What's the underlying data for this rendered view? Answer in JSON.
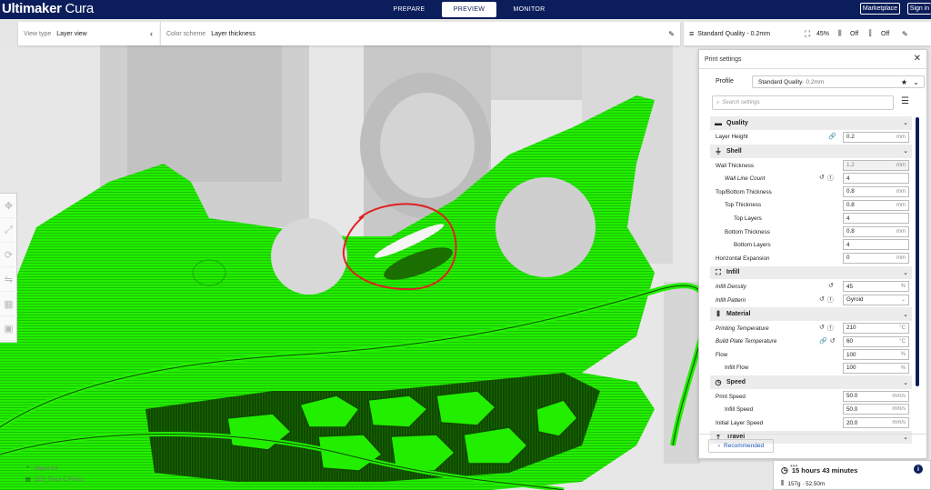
{
  "app": {
    "title_bold": "Ultimaker",
    "title_rest": "Cura"
  },
  "stages": {
    "prepare": "PREPARE",
    "preview": "PREVIEW",
    "monitor": "MONITOR"
  },
  "top_buttons": {
    "marketplace": "Marketplace",
    "signin": "Sign in"
  },
  "view": {
    "view_type_label": "View type",
    "view_type_value": "Layer view",
    "color_scheme_label": "Color scheme",
    "color_scheme_value": "Layer thickness"
  },
  "quick_settings": {
    "profile": "Standard Quality - 0.2mm",
    "infill": "45%",
    "support": "Off",
    "adhesion": "Off"
  },
  "panel": {
    "title": "Print settings",
    "profile_label": "Profile",
    "profile_value": "Standard Quality",
    "profile_suffix": " - 0.2mm",
    "search_placeholder": "Search settings",
    "recommended_button": "Recommended"
  },
  "settings": {
    "quality": {
      "label": "Quality"
    },
    "layer_height": {
      "label": "Layer Height",
      "value": "0.2",
      "unit": "mm"
    },
    "shell": {
      "label": "Shell"
    },
    "wall_thickness": {
      "label": "Wall Thickness",
      "value": "1.2",
      "unit": "mm"
    },
    "wall_line_count": {
      "label": "Wall Line Count",
      "value": "4"
    },
    "top_bottom_thickness": {
      "label": "Top/Bottom Thickness",
      "value": "0.8",
      "unit": "mm"
    },
    "top_thickness": {
      "label": "Top Thickness",
      "value": "0.8",
      "unit": "mm"
    },
    "top_layers": {
      "label": "Top Layers",
      "value": "4"
    },
    "bottom_thickness": {
      "label": "Bottom Thickness",
      "value": "0.8",
      "unit": "mm"
    },
    "bottom_layers": {
      "label": "Bottom Layers",
      "value": "4"
    },
    "horizontal_expansion": {
      "label": "Horizontal Expansion",
      "value": "0",
      "unit": "mm"
    },
    "infill": {
      "label": "Infill"
    },
    "infill_density": {
      "label": "Infill Density",
      "value": "45",
      "unit": "%"
    },
    "infill_pattern": {
      "label": "Infill Pattern",
      "value": "Gyroid"
    },
    "material": {
      "label": "Material"
    },
    "printing_temperature": {
      "label": "Printing Temperature",
      "value": "210",
      "unit": "°C"
    },
    "build_plate_temperature": {
      "label": "Build Plate Temperature",
      "value": "60",
      "unit": "°C"
    },
    "flow": {
      "label": "Flow",
      "value": "100",
      "unit": "%"
    },
    "infill_flow": {
      "label": "Infill Flow",
      "value": "100",
      "unit": "%"
    },
    "speed": {
      "label": "Speed"
    },
    "print_speed": {
      "label": "Print Speed",
      "value": "50.0",
      "unit": "mm/s"
    },
    "infill_speed": {
      "label": "Infill Speed",
      "value": "50.0",
      "unit": "mm/s"
    },
    "initial_layer_speed": {
      "label": "Initial Layer Speed",
      "value": "20.0",
      "unit": "mm/s"
    },
    "travel": {
      "label": "Travel"
    }
  },
  "object_list": {
    "label": "Object list",
    "object_name": "CE3_Truck C Primo"
  },
  "print_info": {
    "time": "15 hours 43 minutes",
    "material": "157g · 52.50m"
  },
  "colors": {
    "topbar": "#0b1e5b",
    "model_green": "#22ee00",
    "annotation_red": "#e02020"
  }
}
